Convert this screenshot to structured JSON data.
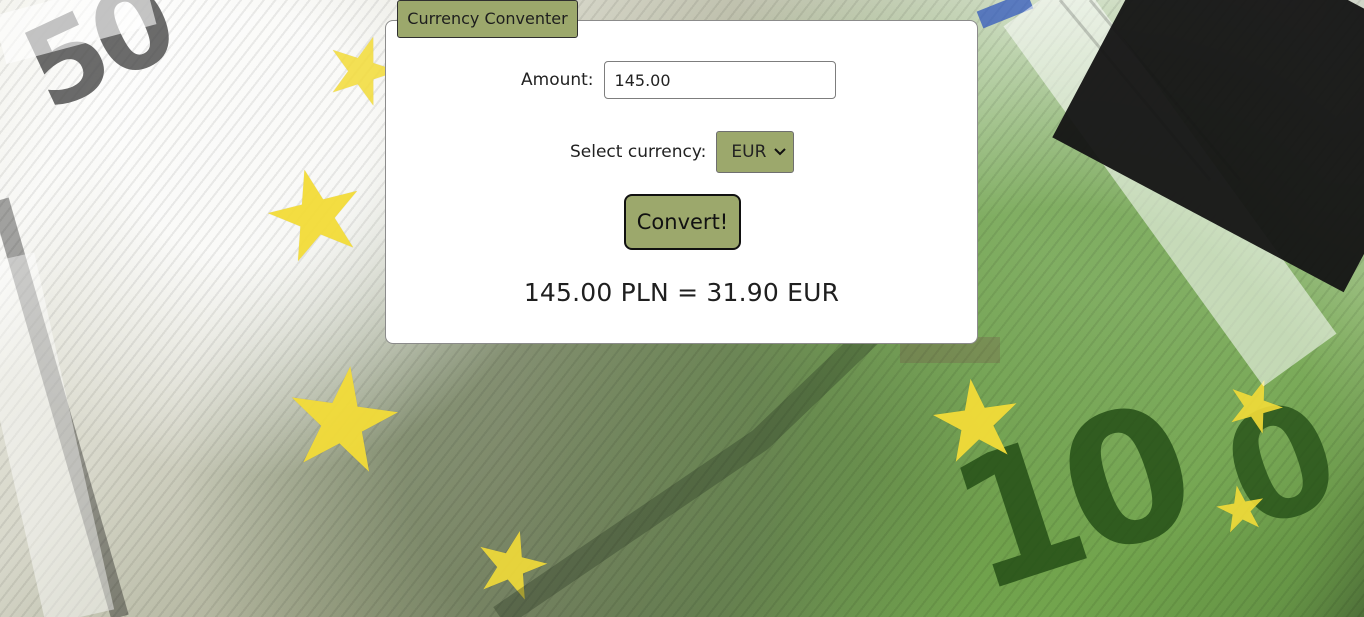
{
  "app": {
    "title": "Currency Conventer"
  },
  "form": {
    "amount_label": "Amount:",
    "amount_value": "145.00",
    "currency_label": "Select currency:",
    "currency_selected": "EUR",
    "convert_label": "Convert!"
  },
  "result": {
    "text": "145.00 PLN = 31.90 EUR"
  },
  "theme": {
    "accent": "#9ca86c",
    "card_background": "#ffffff",
    "text": "#222222"
  },
  "icons": {
    "select_arrow": "chevron-down-icon"
  }
}
